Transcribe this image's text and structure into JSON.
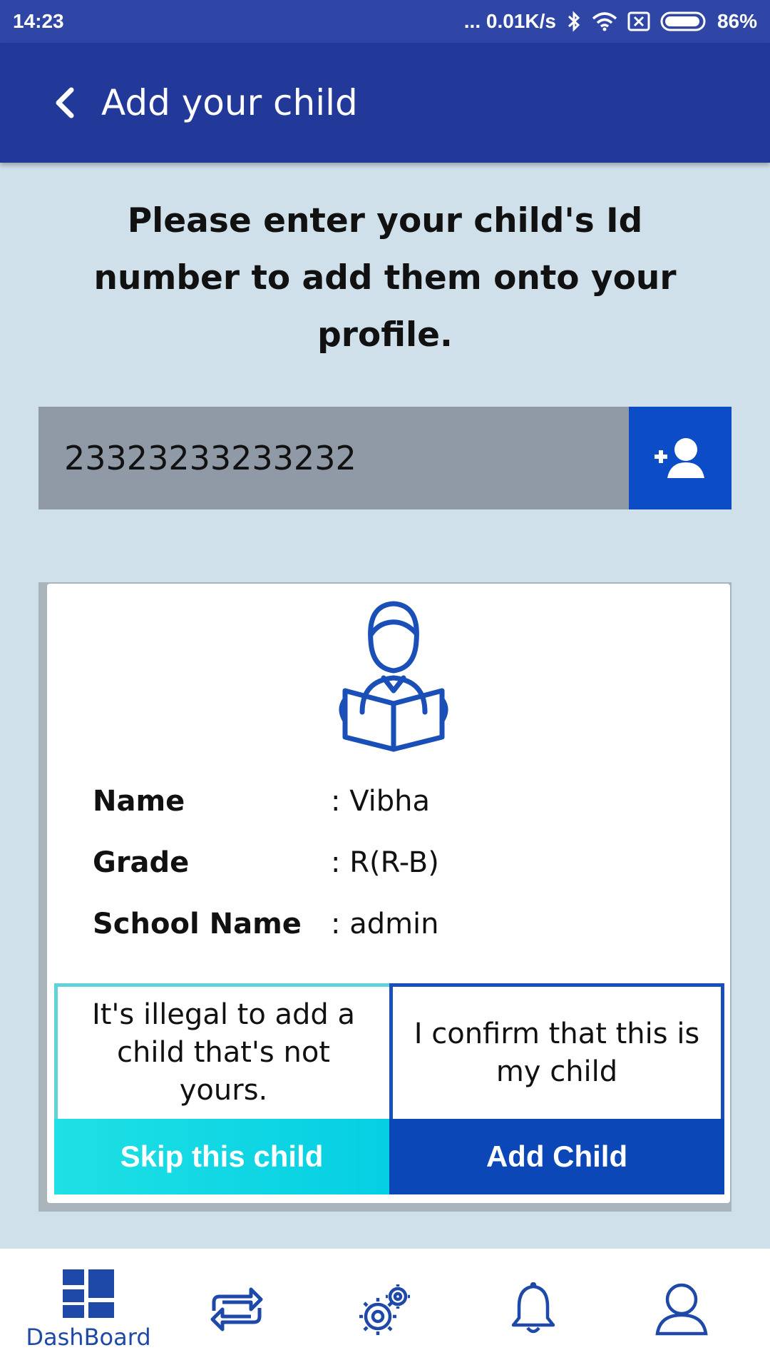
{
  "status_bar": {
    "time": "14:23",
    "network_speed": "... 0.01K/s",
    "battery": "86%"
  },
  "app_bar": {
    "title": "Add your child"
  },
  "instruction": "Please enter your child's Id number to add them onto your profile.",
  "child_id_input": {
    "value": "23323233233232"
  },
  "child_card": {
    "fields": [
      {
        "label": "Name",
        "value": ": Vibha"
      },
      {
        "label": "Grade",
        "value": ": R(R-B)"
      },
      {
        "label": "School Name",
        "value": ": admin"
      }
    ],
    "illegal_notice": "It's illegal to add a child that's not yours.",
    "confirm_notice": "I confirm that this is my child",
    "skip_button": "Skip this child",
    "add_button": "Add Child"
  },
  "bottom_nav": {
    "items": [
      {
        "label": "DashBoard",
        "icon": "dashboard-icon"
      },
      {
        "label": "",
        "icon": "transfer-icon"
      },
      {
        "label": "",
        "icon": "settings-icon"
      },
      {
        "label": "",
        "icon": "bell-icon"
      },
      {
        "label": "",
        "icon": "profile-icon"
      }
    ]
  },
  "colors": {
    "app_bar": "#22399a",
    "background": "#cfe0ea",
    "accent_blue": "#0c47b8",
    "skip_cyan": "#05cfe3"
  }
}
